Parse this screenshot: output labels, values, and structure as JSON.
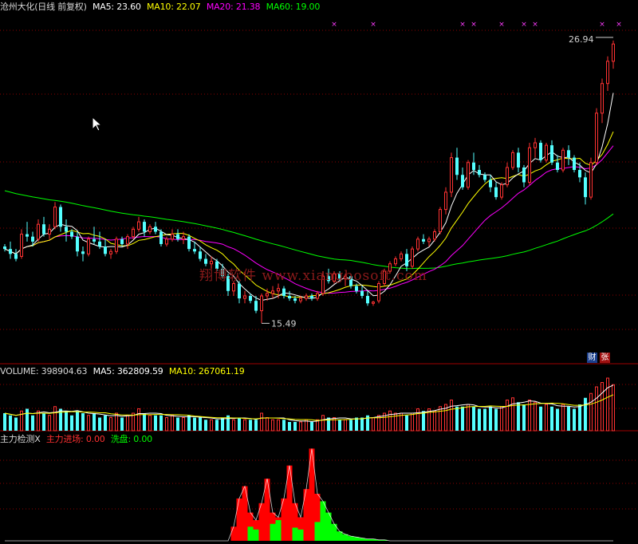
{
  "header": {
    "title": "沧州大化(日线 前复权)",
    "ma5": "MA5: 23.60",
    "ma10": "MA10: 22.07",
    "ma20": "MA20: 21.38",
    "ma60": "MA60: 19.00"
  },
  "volume_header": {
    "volume": "VOLUME: 398904.63",
    "ma5": "MA5: 362809.59",
    "ma10": "MA10: 267061.19"
  },
  "indicator_header": {
    "name": "主力检测X",
    "main_entry": "主力进场: 0.00",
    "wash": "洗盘: 0.00"
  },
  "watermark": "翔博软件 www.xiangbosoft.com",
  "badges": {
    "cai": "财",
    "zhang": "张"
  },
  "colors": {
    "background": "#000000",
    "up": "#ff3232",
    "down": "#54ffff",
    "ma5": "#ffffff",
    "ma10": "#ffff00",
    "ma20": "#ff00ff",
    "ma60": "#00ff00",
    "grid": "#8b0000",
    "main_entry": "#ff0000",
    "wash": "#00ff00"
  },
  "chart_data": {
    "type": "candlestick",
    "annotations": [
      {
        "label": "26.94",
        "kind": "max_price"
      },
      {
        "label": "15.49",
        "kind": "min_price"
      }
    ],
    "price_ylim": [
      14.5,
      28
    ],
    "candles_ohlc": [
      [
        18.6,
        18.7,
        18.4,
        18.5
      ],
      [
        18.5,
        18.8,
        18.1,
        18.3
      ],
      [
        18.3,
        18.5,
        18.0,
        18.1
      ],
      [
        18.2,
        19.3,
        18.1,
        19.1
      ],
      [
        19.1,
        19.6,
        18.8,
        19.0
      ],
      [
        19.0,
        19.2,
        18.6,
        18.8
      ],
      [
        18.9,
        19.7,
        18.8,
        19.5
      ],
      [
        19.5,
        19.8,
        19.0,
        19.1
      ],
      [
        19.1,
        19.5,
        18.9,
        19.3
      ],
      [
        19.4,
        20.4,
        19.3,
        20.2
      ],
      [
        20.2,
        20.3,
        19.2,
        19.4
      ],
      [
        19.4,
        19.7,
        18.8,
        19.2
      ],
      [
        19.2,
        19.3,
        18.9,
        19.0
      ],
      [
        19.0,
        19.2,
        18.2,
        18.4
      ],
      [
        18.4,
        18.6,
        18.0,
        18.3
      ],
      [
        18.3,
        19.0,
        18.2,
        18.9
      ],
      [
        18.9,
        19.4,
        18.7,
        18.8
      ],
      [
        18.8,
        19.2,
        18.5,
        18.6
      ],
      [
        18.6,
        18.9,
        18.2,
        18.3
      ],
      [
        18.3,
        18.5,
        18.1,
        18.4
      ],
      [
        18.4,
        19.0,
        18.3,
        18.9
      ],
      [
        18.9,
        19.0,
        18.6,
        18.7
      ],
      [
        18.7,
        19.1,
        18.5,
        19.0
      ],
      [
        19.0,
        19.4,
        18.9,
        19.3
      ],
      [
        19.3,
        19.8,
        19.2,
        19.6
      ],
      [
        19.6,
        19.7,
        19.0,
        19.2
      ],
      [
        19.2,
        19.5,
        19.1,
        19.4
      ],
      [
        19.4,
        19.6,
        19.1,
        19.2
      ],
      [
        19.2,
        19.3,
        18.6,
        18.7
      ],
      [
        18.7,
        19.0,
        18.6,
        18.9
      ],
      [
        18.9,
        19.3,
        18.8,
        19.1
      ],
      [
        19.1,
        19.3,
        18.8,
        18.9
      ],
      [
        18.9,
        19.2,
        18.7,
        19.0
      ],
      [
        19.0,
        19.1,
        18.4,
        18.5
      ],
      [
        18.5,
        18.8,
        18.3,
        18.4
      ],
      [
        18.4,
        18.6,
        18.0,
        18.1
      ],
      [
        18.1,
        18.3,
        17.8,
        17.9
      ],
      [
        17.9,
        18.2,
        17.7,
        18.0
      ],
      [
        18.0,
        18.1,
        17.6,
        17.7
      ],
      [
        17.7,
        17.9,
        17.3,
        17.4
      ],
      [
        17.4,
        17.5,
        16.6,
        16.8
      ],
      [
        16.8,
        17.2,
        16.6,
        17.1
      ],
      [
        17.1,
        17.2,
        16.3,
        16.5
      ],
      [
        16.5,
        16.8,
        16.3,
        16.6
      ],
      [
        16.6,
        16.7,
        16.3,
        16.4
      ],
      [
        16.4,
        16.6,
        15.9,
        16.0
      ],
      [
        16.0,
        16.7,
        15.5,
        16.6
      ],
      [
        16.6,
        16.9,
        16.4,
        16.7
      ],
      [
        16.7,
        17.0,
        16.5,
        16.8
      ],
      [
        16.8,
        17.1,
        16.5,
        16.9
      ],
      [
        16.9,
        17.0,
        16.5,
        16.6
      ],
      [
        16.6,
        16.8,
        16.4,
        16.5
      ],
      [
        16.5,
        16.6,
        16.3,
        16.4
      ],
      [
        16.4,
        16.6,
        16.3,
        16.5
      ],
      [
        16.5,
        16.7,
        16.4,
        16.6
      ],
      [
        16.6,
        16.7,
        16.4,
        16.5
      ],
      [
        16.5,
        16.8,
        16.4,
        16.7
      ],
      [
        16.7,
        17.6,
        16.6,
        17.4
      ],
      [
        17.4,
        17.7,
        17.1,
        17.2
      ],
      [
        17.2,
        17.6,
        17.1,
        17.5
      ],
      [
        17.5,
        17.6,
        17.2,
        17.3
      ],
      [
        17.3,
        17.5,
        17.0,
        17.4
      ],
      [
        17.4,
        17.5,
        16.9,
        17.0
      ],
      [
        17.0,
        17.1,
        16.7,
        16.8
      ],
      [
        16.8,
        17.0,
        16.5,
        16.6
      ],
      [
        16.6,
        16.8,
        16.2,
        16.3
      ],
      [
        16.3,
        16.4,
        16.2,
        16.35
      ],
      [
        16.4,
        17.2,
        16.3,
        17.1
      ],
      [
        17.1,
        17.7,
        17.0,
        17.6
      ],
      [
        17.6,
        18.0,
        17.5,
        17.9
      ],
      [
        17.9,
        18.2,
        17.8,
        18.1
      ],
      [
        18.1,
        18.4,
        18.0,
        18.3
      ],
      [
        18.3,
        18.5,
        17.6,
        17.8
      ],
      [
        17.8,
        18.6,
        17.7,
        18.5
      ],
      [
        18.5,
        19.0,
        18.4,
        18.9
      ],
      [
        18.9,
        19.1,
        18.7,
        18.8
      ],
      [
        18.8,
        19.0,
        18.6,
        18.9
      ],
      [
        18.9,
        19.3,
        18.8,
        19.2
      ],
      [
        19.2,
        20.2,
        19.1,
        20.1
      ],
      [
        20.1,
        21.0,
        19.9,
        20.8
      ],
      [
        20.8,
        22.4,
        20.6,
        22.2
      ],
      [
        22.2,
        22.6,
        21.3,
        21.5
      ],
      [
        21.5,
        21.8,
        20.9,
        21.0
      ],
      [
        21.0,
        22.1,
        20.9,
        22.0
      ],
      [
        22.0,
        22.4,
        21.5,
        21.7
      ],
      [
        21.7,
        21.9,
        21.4,
        21.5
      ],
      [
        21.5,
        21.6,
        21.2,
        21.3
      ],
      [
        21.3,
        21.5,
        20.8,
        21.0
      ],
      [
        21.0,
        21.2,
        20.5,
        20.6
      ],
      [
        20.6,
        21.2,
        20.5,
        21.1
      ],
      [
        21.1,
        22.0,
        21.0,
        21.8
      ],
      [
        21.8,
        22.5,
        21.7,
        22.4
      ],
      [
        22.4,
        22.6,
        21.6,
        21.8
      ],
      [
        21.8,
        21.9,
        21.0,
        21.2
      ],
      [
        21.2,
        22.8,
        21.1,
        22.6
      ],
      [
        22.6,
        23.0,
        22.2,
        22.8
      ],
      [
        22.8,
        22.9,
        22.0,
        22.1
      ],
      [
        22.1,
        22.8,
        22.0,
        22.7
      ],
      [
        22.7,
        22.9,
        21.9,
        22.0
      ],
      [
        22.0,
        22.3,
        21.6,
        21.7
      ],
      [
        21.7,
        22.6,
        21.6,
        22.5
      ],
      [
        22.5,
        22.7,
        21.9,
        22.2
      ],
      [
        22.2,
        22.3,
        21.6,
        21.7
      ],
      [
        21.7,
        22.0,
        21.2,
        21.4
      ],
      [
        21.4,
        21.6,
        20.3,
        20.6
      ],
      [
        20.6,
        22.2,
        20.5,
        22.0
      ],
      [
        22.0,
        24.2,
        21.9,
        24.0
      ],
      [
        24.0,
        25.4,
        23.6,
        25.2
      ],
      [
        25.2,
        26.3,
        24.9,
        26.1
      ],
      [
        26.1,
        26.94,
        25.8,
        26.8
      ]
    ],
    "volume": [
      0.08,
      0.07,
      0.06,
      0.09,
      0.1,
      0.07,
      0.09,
      0.08,
      0.07,
      0.11,
      0.1,
      0.09,
      0.07,
      0.09,
      0.08,
      0.07,
      0.08,
      0.06,
      0.07,
      0.06,
      0.08,
      0.06,
      0.07,
      0.08,
      0.1,
      0.08,
      0.07,
      0.07,
      0.07,
      0.06,
      0.07,
      0.06,
      0.06,
      0.07,
      0.06,
      0.06,
      0.05,
      0.05,
      0.05,
      0.06,
      0.07,
      0.05,
      0.06,
      0.05,
      0.05,
      0.05,
      0.08,
      0.06,
      0.05,
      0.05,
      0.05,
      0.04,
      0.04,
      0.04,
      0.05,
      0.04,
      0.05,
      0.07,
      0.06,
      0.06,
      0.05,
      0.05,
      0.05,
      0.06,
      0.06,
      0.07,
      0.06,
      0.07,
      0.08,
      0.09,
      0.08,
      0.08,
      0.07,
      0.08,
      0.1,
      0.09,
      0.1,
      0.09,
      0.11,
      0.12,
      0.14,
      0.11,
      0.11,
      0.12,
      0.11,
      0.1,
      0.1,
      0.11,
      0.1,
      0.11,
      0.14,
      0.15,
      0.13,
      0.12,
      0.14,
      0.13,
      0.11,
      0.12,
      0.11,
      0.1,
      0.12,
      0.11,
      0.1,
      0.12,
      0.15,
      0.17,
      0.2,
      0.22,
      0.24,
      0.21
    ],
    "indicator_ylim": [
      0,
      1
    ],
    "main_entry": [
      0,
      0,
      0,
      0,
      0,
      0,
      0,
      0,
      0,
      0,
      0,
      0,
      0,
      0,
      0,
      0,
      0,
      0,
      0,
      0,
      0,
      0,
      0,
      0,
      0,
      0,
      0,
      0,
      0,
      0,
      0,
      0,
      0,
      0,
      0,
      0,
      0,
      0,
      0,
      0,
      0,
      0.15,
      0.45,
      0.58,
      0.3,
      0.22,
      0.4,
      0.66,
      0.3,
      0.25,
      0.45,
      0.8,
      0.4,
      0.25,
      0.55,
      0.98,
      0.5,
      0.2,
      0.1,
      0.05,
      0,
      0,
      0,
      0,
      0,
      0,
      0,
      0,
      0,
      0,
      0,
      0,
      0,
      0,
      0,
      0,
      0,
      0,
      0,
      0,
      0,
      0,
      0,
      0,
      0,
      0,
      0,
      0,
      0,
      0,
      0,
      0,
      0,
      0,
      0,
      0,
      0,
      0,
      0,
      0,
      0,
      0,
      0,
      0,
      0,
      0,
      0,
      0,
      0,
      0
    ],
    "wash": [
      0,
      0,
      0,
      0,
      0,
      0,
      0,
      0,
      0,
      0,
      0,
      0,
      0,
      0,
      0,
      0,
      0,
      0,
      0,
      0,
      0,
      0,
      0,
      0,
      0,
      0,
      0,
      0,
      0,
      0,
      0,
      0,
      0,
      0,
      0,
      0,
      0,
      0,
      0,
      0,
      0,
      0,
      0,
      0,
      0.15,
      0.12,
      0,
      0,
      0.18,
      0.22,
      0,
      0,
      0.14,
      0.12,
      0,
      0,
      0.2,
      0.42,
      0.3,
      0.18,
      0.1,
      0.07,
      0.05,
      0.04,
      0.03,
      0.02,
      0.02,
      0.01,
      0.01,
      0,
      0,
      0,
      0,
      0,
      0,
      0,
      0,
      0,
      0,
      0,
      0,
      0,
      0,
      0,
      0,
      0,
      0,
      0,
      0,
      0,
      0,
      0,
      0,
      0,
      0,
      0,
      0,
      0,
      0,
      0,
      0,
      0,
      0,
      0,
      0,
      0,
      0,
      0,
      0,
      0
    ]
  }
}
